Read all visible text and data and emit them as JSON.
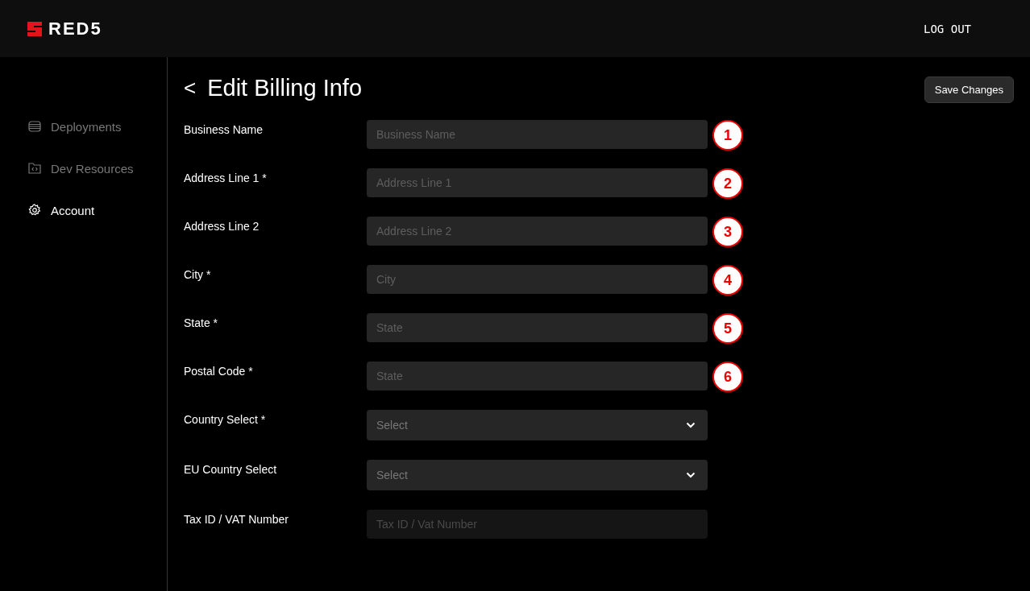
{
  "header": {
    "logo": "RED5",
    "logout": "LOG OUT"
  },
  "sidebar": {
    "items": [
      {
        "label": "Deployments",
        "selected": false
      },
      {
        "label": "Dev Resources",
        "selected": false
      },
      {
        "label": "Account",
        "selected": true
      }
    ]
  },
  "page": {
    "back": "<",
    "title": "Edit Billing Info",
    "save_button": "Save Changes"
  },
  "fields": [
    {
      "label": "Business Name",
      "kind": "text",
      "placeholder": "Business Name",
      "disabled": false,
      "annotation": "1"
    },
    {
      "label": "Address Line 1 *",
      "kind": "text",
      "placeholder": "Address Line 1",
      "disabled": false,
      "annotation": "2"
    },
    {
      "label": "Address Line 2",
      "kind": "text",
      "placeholder": "Address Line 2",
      "disabled": false,
      "annotation": "3"
    },
    {
      "label": "City *",
      "kind": "text",
      "placeholder": "City",
      "disabled": false,
      "annotation": "4"
    },
    {
      "label": "State *",
      "kind": "text",
      "placeholder": "State",
      "disabled": false,
      "annotation": "5"
    },
    {
      "label": "Postal Code *",
      "kind": "text",
      "placeholder": "State",
      "disabled": false,
      "annotation": "6"
    },
    {
      "label": "Country Select *",
      "kind": "select",
      "value": "Select",
      "disabled": false
    },
    {
      "label": "EU Country Select",
      "kind": "select",
      "value": "Select",
      "disabled": false
    },
    {
      "label": "Tax ID / VAT Number",
      "kind": "text",
      "placeholder": "Tax ID / Vat Number",
      "disabled": true
    }
  ]
}
